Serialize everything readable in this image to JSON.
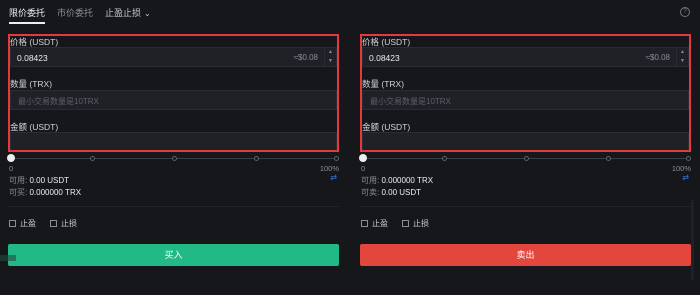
{
  "tabs": [
    {
      "label": "限价委托"
    },
    {
      "label": "市价委托"
    },
    {
      "label": "止盈止损"
    }
  ],
  "buy_panel": {
    "price_label": "价格 (USDT)",
    "price_value": "0.08423",
    "price_approx": "≈$0.08",
    "qty_label": "数量 (TRX)",
    "qty_placeholder": "最小交易数量是10TRX",
    "total_label": "金额 (USDT)",
    "slider_min": "0",
    "slider_max": "100%",
    "slider_percent": 0,
    "avail_label": "可用:",
    "avail_value": "0.00 USDT",
    "can_label": "可买:",
    "can_value": "0.000000 TRX",
    "tp_label": "止盈",
    "sl_label": "止损",
    "button_label": "买入"
  },
  "sell_panel": {
    "price_label": "价格 (USDT)",
    "price_value": "0.08423",
    "price_approx": "≈$0.08",
    "qty_label": "数量 (TRX)",
    "qty_placeholder": "最小交易数量是10TRX",
    "total_label": "金额 (USDT)",
    "slider_min": "0",
    "slider_max": "100%",
    "slider_percent": 0,
    "avail_label": "可用:",
    "avail_value": "0.000000 TRX",
    "can_label": "可卖:",
    "can_value": "0.00 USDT",
    "tp_label": "止盈",
    "sl_label": "止损",
    "button_label": "卖出"
  },
  "colors": {
    "buy": "#21b985",
    "sell": "#e2463d",
    "highlight_frame": "#e13b3b"
  },
  "icons": [
    "chevron-down-icon",
    "help-icon",
    "swap-icon",
    "stepper-up-icon",
    "stepper-down-icon"
  ]
}
